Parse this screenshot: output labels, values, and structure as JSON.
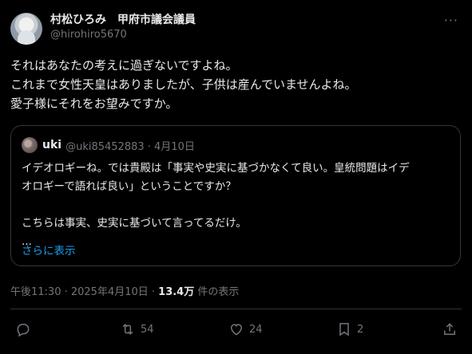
{
  "author": {
    "display_name": "村松ひろみ　甲府市議会議員",
    "handle": "@hirohiro5670"
  },
  "post": {
    "lines": [
      "それはあなたの考えに過ぎないですよね。",
      "これまで女性天皇はありましたが、子供は産んでいませんよね。",
      "愛子様にそれをお望みですか。"
    ]
  },
  "quoted": {
    "name": "uki",
    "meta": "@uki85452883 · 4月10日",
    "lines": [
      "イデオロギーね。では貴殿は「事実や史実に基づかなくて良い。皇統問題はイデ",
      "オロギーで語れば良い」ということですか？",
      "",
      "こちらは事実、史実に基づいて言ってるだけ。",
      "..."
    ],
    "show_more": "さらに表示"
  },
  "meta": {
    "timestamp": "午後11:30 · 2025年4月10日 · ",
    "views_count": "13.4万",
    "views_label": " 件の表示"
  },
  "actions": {
    "reposts": "54",
    "likes": "24",
    "bookmarks": "2"
  },
  "icons": [
    "reply-icon",
    "repost-icon",
    "like-icon",
    "bookmark-icon",
    "share-icon",
    "more-icon"
  ],
  "colors": {
    "background": "#000000",
    "text": "#e7e9ea",
    "muted": "#71767b",
    "link": "#1d9bf0"
  }
}
